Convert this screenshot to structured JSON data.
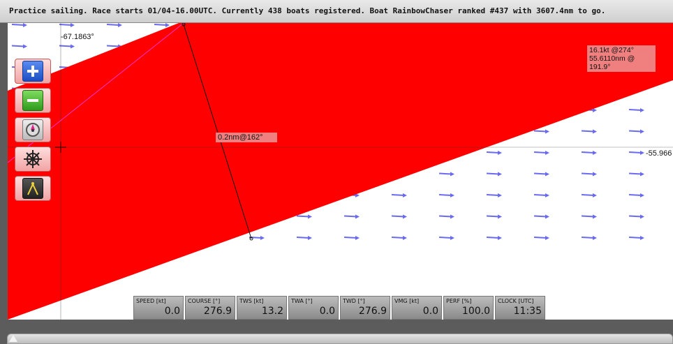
{
  "title_bar": {
    "message": "Practice sailing. Race starts 01/04-16.00UTC. Currently 438 boats registered. Boat RainbowChaser ranked #437 with 3607.4nm to go."
  },
  "map": {
    "lat_readout": "-67.1863°",
    "lon_readout": "-55.966",
    "measure_label": "0.2nm@162°",
    "boat_info": {
      "line1": "16.1kt @274°",
      "line2": "55.6110nm @ 191.9°"
    },
    "colors": {
      "zone": "#ff0000",
      "wind_arrow": "#6a6af0",
      "course_line": "#ff33cc"
    }
  },
  "toolbar": {
    "buttons": [
      {
        "name": "zoom-in-button",
        "icon": "plus-icon"
      },
      {
        "name": "zoom-out-button",
        "icon": "minus-icon"
      },
      {
        "name": "center-boat-button",
        "icon": "compass-icon"
      },
      {
        "name": "helm-button",
        "icon": "ship-wheel-icon"
      },
      {
        "name": "measure-button",
        "icon": "divider-compass-icon"
      }
    ]
  },
  "status": [
    {
      "label": "SPEED [kt]",
      "value": "0.0"
    },
    {
      "label": "COURSE [°]",
      "value": "276.9"
    },
    {
      "label": "TWS [kt]",
      "value": "13.2"
    },
    {
      "label": "TWA [°]",
      "value": "0.0"
    },
    {
      "label": "TWD [°]",
      "value": "276.9"
    },
    {
      "label": "VMG [kt]",
      "value": "0.0"
    },
    {
      "label": "PERF [%]",
      "value": "100.0"
    },
    {
      "label": "CLOCK [UTC]",
      "value": "11:35"
    }
  ],
  "timeline": {
    "position": 0.0
  }
}
